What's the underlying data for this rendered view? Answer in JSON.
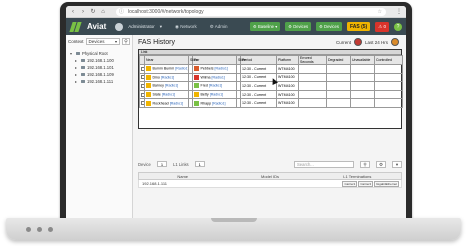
{
  "browser": {
    "url": "localhost:3000/#/network/topology"
  },
  "header": {
    "logo": "Aviat",
    "user": "Administrator",
    "nav_network": "Network",
    "nav_admin": "Admin",
    "btn_baseline": "Baseline",
    "btn_devices": "Devices",
    "btn_devices2": "Devices",
    "fas_badge": "FAS (5)",
    "alarm_badge": "0"
  },
  "sidebar": {
    "context_label": "Context",
    "context_value": "Devices",
    "tree": [
      {
        "label": "Physical Root",
        "child": false
      },
      {
        "label": "192.168.1.100",
        "child": true
      },
      {
        "label": "192.168.1.101",
        "child": true
      },
      {
        "label": "192.168.1.109",
        "child": true
      },
      {
        "label": "192.168.1.111",
        "child": true
      }
    ]
  },
  "fas": {
    "title": "FAS History",
    "current_label": "Current",
    "last_label": "Last 24 Hrs",
    "group_header": "Link",
    "columns": [
      "",
      "Near",
      "Slice",
      "Far",
      "Slice",
      "Period",
      "Platform",
      "Errored Seconds",
      "Degraded",
      "Unavailable",
      "Controlled"
    ],
    "rows": [
      {
        "near": "Bumm Bumm",
        "near_color": "#f0b400",
        "far": "Pebbels",
        "far_color": "#d95a2a",
        "period": "12:30 - Current",
        "platform": "WTM4100"
      },
      {
        "near": "Dino",
        "near_color": "#f0b400",
        "far": "Wilma",
        "far_color": "#d9342b",
        "period": "12:30 - Current",
        "platform": "WTM4100"
      },
      {
        "near": "Barney",
        "near_color": "#f0b400",
        "far": "Fred",
        "far_color": "#79c144",
        "period": "12:30 - Current",
        "platform": "WTM4100"
      },
      {
        "near": "Slate",
        "near_color": "#f0b400",
        "far": "Betty",
        "far_color": "#f0b400",
        "period": "12:30 - Current",
        "platform": "WTM4100"
      },
      {
        "near": "Rockhead",
        "near_color": "#f0b400",
        "far": "Rhapp",
        "far_color": "#79c144",
        "period": "12:30 - Current",
        "platform": "WTM4100"
      }
    ],
    "radio_link": "[Radio1]"
  },
  "bottom": {
    "tab_device": "Device",
    "tab_device_sel": "1",
    "tab_links": "L1 Links",
    "tab_links_sel": "1",
    "search_placeholder": "Search...",
    "columns": [
      "Name",
      "Model IDs",
      "L1 Terminations"
    ],
    "row": {
      "name": "192.168.1.111",
      "model": "",
      "terminations": [
        "Carrier1",
        "Carrier2",
        "GigabitEthernet"
      ]
    }
  }
}
